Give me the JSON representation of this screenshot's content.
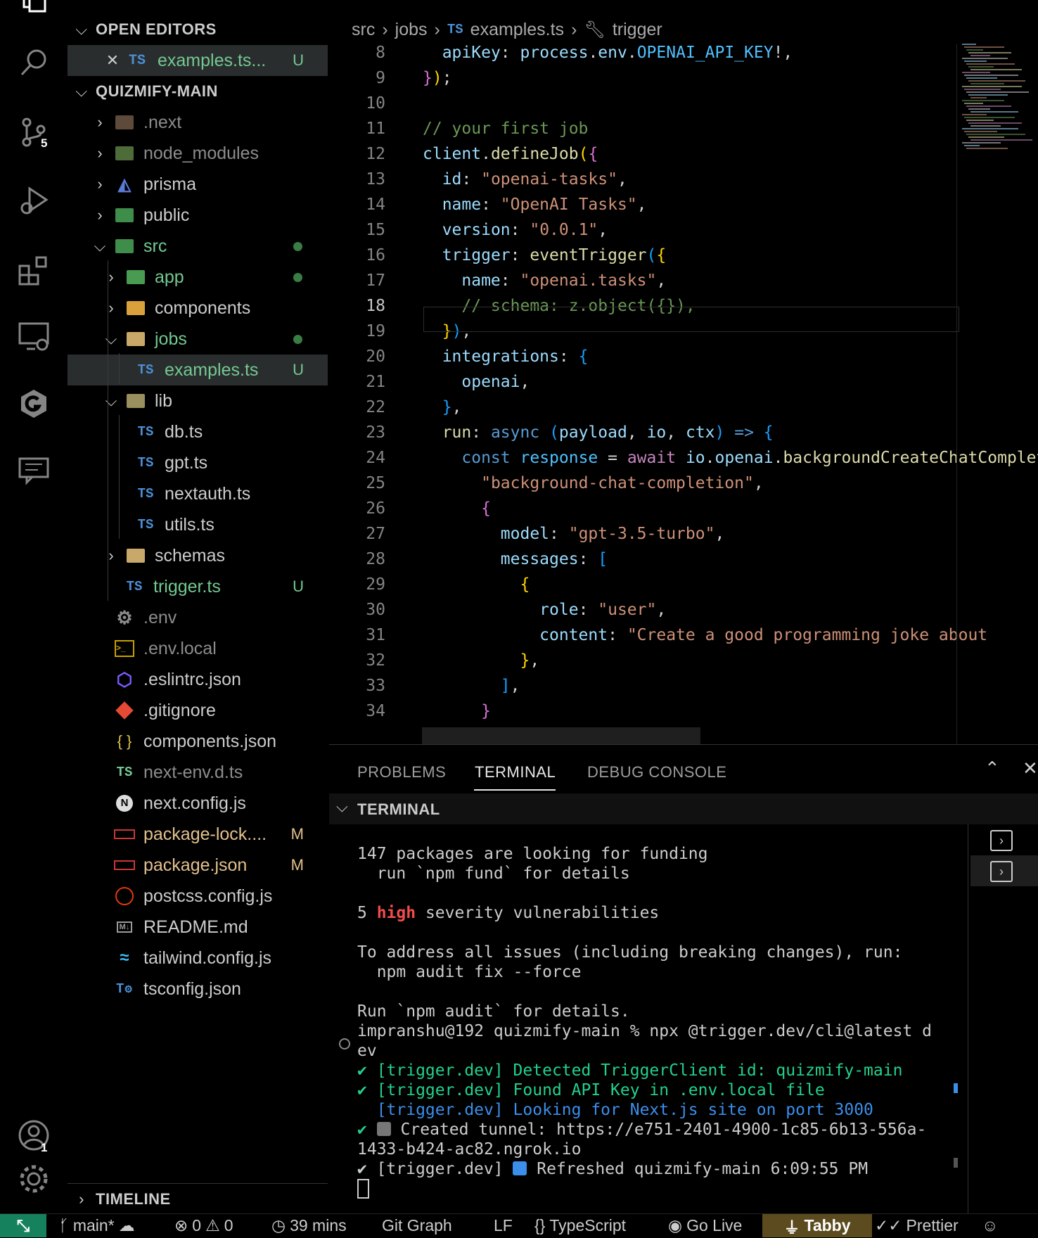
{
  "sidebar": {
    "open_editors_title": "OPEN EDITORS",
    "open_editor": {
      "icon": "TS",
      "name": "examples.ts...",
      "status": "U"
    },
    "project_title": "QUIZMIFY-MAIN",
    "tree": [
      {
        "name": ".next",
        "status": ""
      },
      {
        "name": "node_modules",
        "status": ""
      },
      {
        "name": "prisma",
        "status": ""
      },
      {
        "name": "public",
        "status": ""
      },
      {
        "name": "src",
        "status": ""
      },
      {
        "name": "app",
        "status": ""
      },
      {
        "name": "components",
        "status": ""
      },
      {
        "name": "jobs",
        "status": ""
      },
      {
        "name": "examples.ts",
        "status": "U"
      },
      {
        "name": "lib",
        "status": ""
      },
      {
        "name": "db.ts",
        "status": ""
      },
      {
        "name": "gpt.ts",
        "status": ""
      },
      {
        "name": "nextauth.ts",
        "status": ""
      },
      {
        "name": "utils.ts",
        "status": ""
      },
      {
        "name": "schemas",
        "status": ""
      },
      {
        "name": "trigger.ts",
        "status": "U"
      },
      {
        "name": ".env",
        "status": ""
      },
      {
        "name": ".env.local",
        "status": ""
      },
      {
        "name": ".eslintrc.json",
        "status": ""
      },
      {
        "name": ".gitignore",
        "status": ""
      },
      {
        "name": "components.json",
        "status": ""
      },
      {
        "name": "next-env.d.ts",
        "status": ""
      },
      {
        "name": "next.config.js",
        "status": ""
      },
      {
        "name": "package-lock....",
        "status": "M"
      },
      {
        "name": "package.json",
        "status": "M"
      },
      {
        "name": "postcss.config.js",
        "status": ""
      },
      {
        "name": "README.md",
        "status": ""
      },
      {
        "name": "tailwind.config.js",
        "status": ""
      },
      {
        "name": "tsconfig.json",
        "status": ""
      }
    ],
    "ts_label": "TS",
    "timeline_title": "TIMELINE"
  },
  "activity": {
    "scm_badge": "5",
    "accounts_badge": "1"
  },
  "breadcrumb": [
    "src",
    "jobs",
    "examples.ts",
    "trigger"
  ],
  "breadcrumb_ts": "TS",
  "editor": {
    "line_numbers": [
      "8",
      "9",
      "10",
      "11",
      "12",
      "13",
      "14",
      "15",
      "16",
      "17",
      "18",
      "19",
      "20",
      "21",
      "22",
      "23",
      "24",
      "25",
      "26",
      "27",
      "28",
      "29",
      "30",
      "31",
      "32",
      "33",
      "34"
    ]
  },
  "panel": {
    "tabs": [
      "PROBLEMS",
      "TERMINAL",
      "DEBUG CONSOLE"
    ],
    "terminal_title": "TERMINAL",
    "lines": {
      "l1": "147 packages are looking for funding",
      "l2": "  run `npm fund` for details",
      "l3a": "5 ",
      "l3b": "high",
      "l3c": " severity vulnerabilities",
      "l4": "To address all issues (including breaking changes), run:",
      "l5": "  npm audit fix --force",
      "l6": "Run `npm audit` for details.",
      "l7": "impranshu@192 quizmify-main % npx @trigger.dev/cli@latest d",
      "l8": "ev",
      "l9": "✔ [trigger.dev] Detected TriggerClient id: quizmify-main",
      "l10": "✔ [trigger.dev] Found API Key in .env.local file",
      "l11": "  [trigger.dev] Looking for Next.js site on port 3000",
      "l12a": "✔ ",
      "l12b": " Created tunnel: https://e751-2401-4900-1c85-6b13-556a-",
      "l13": "1433-b424-ac82.ngrok.io",
      "l14a": "✔ [trigger.dev] ",
      "l14b": " Refreshed quizmify-main 6:09:55 PM"
    }
  },
  "status": {
    "branch": "main*",
    "errors": "0",
    "warnings": "0",
    "time": "39 mins",
    "git_graph": "Git Graph",
    "eol": "LF",
    "lang_braces": "{}",
    "language": "TypeScript",
    "golive": "Go Live",
    "tabby": "Tabby",
    "prettier": "Prettier"
  },
  "colors": {
    "accent": "#5b4b1e",
    "remote": "#16825d",
    "untracked": "#73c991",
    "modified": "#e2c08d"
  }
}
